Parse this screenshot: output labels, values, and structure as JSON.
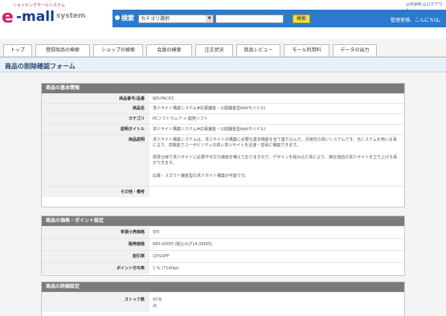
{
  "brand": {
    "subtitle": "ショッピングモールシステム",
    "e": "e",
    "mall": "-mall",
    "system": "system"
  },
  "toplinks": "◎HOME ◎ログアウト",
  "search": {
    "label": "検索",
    "category": "カテゴリ選択",
    "button": "検索"
  },
  "greeting": "管理者様、こんにちは。",
  "tabs": [
    "トップ",
    "登録商品の検索",
    "ショップの検索",
    "会員の検索",
    "注文状況",
    "商品レビュー",
    "モール利用料",
    "データの出力"
  ],
  "page_title": "商品の削除確認フォーム",
  "sections": {
    "basic": {
      "title": "商品の基本情報",
      "rows": [
        {
          "k": "商品番号/品番",
          "v": "WS-PACK3"
        },
        {
          "k": "商品名",
          "v": "求人サイト構築システム#応募課金・公開課金型AddモバイルI"
        },
        {
          "k": "カテゴリ",
          "v": "PCソフトウェア > 開発ソフト"
        },
        {
          "k": "説明タイトル",
          "v": "求人サイト構築システム#応募課金・公開課金型AddモバイルI"
        },
        {
          "k": "商品説明",
          "v1": "求人サイト構築システムは、求人サイトの構築に必要な基本機能を全て盛り込んだ、汎用性の高いシステムです。当システムを用いる事により、高機能でユーザビリティの高い求人サイトを迅速・容易に構築できます。",
          "v2": "標準仕様で求人サイトに必要不可欠な機能を備えておりますので、デザインを組み込む事により、御社独自の求人サイトを立ち上げる事ができます。",
          "v3": "応募・スカウト課金型の求人サイト構築が可能です。"
        },
        {
          "k": "その他・備考",
          "v": ""
        }
      ]
    },
    "price": {
      "title": "商品の価格・ポイント設定",
      "rows": [
        {
          "k": "希望小売価格",
          "v": "0円"
        },
        {
          "k": "販売価格",
          "v": "680,000円 (税込み)714,000円)"
        },
        {
          "k": "割引率",
          "v": "10%OFF"
        },
        {
          "k": "ポイント付与率",
          "v": "1 % (7140pt)"
        }
      ]
    },
    "detail": {
      "title": "商品の詳細設定",
      "rows": [
        {
          "k": "ストック数",
          "v1": "97点",
          "v2": "点"
        }
      ]
    }
  }
}
